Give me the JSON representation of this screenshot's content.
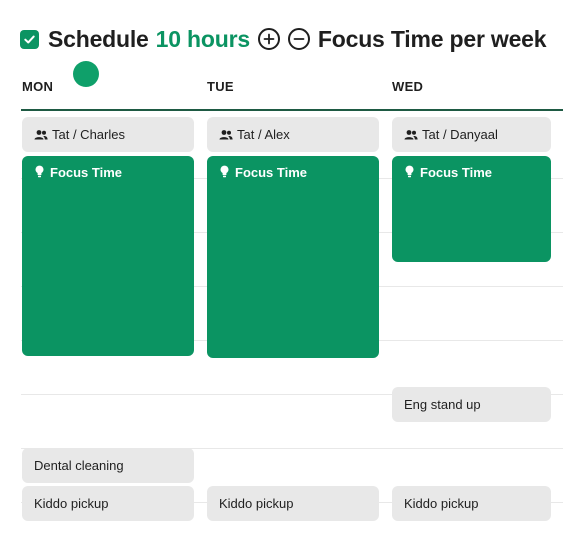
{
  "header": {
    "schedule_label": "Schedule",
    "hours_value": "10 hours",
    "tail_label": "Focus Time per week"
  },
  "colors": {
    "accent": "#0b9462",
    "event_gray": "#e8e8e8",
    "rule": "#1e5a43"
  },
  "days": [
    {
      "label": "MON",
      "meeting": "Tat / Charles",
      "focus": "Focus Time",
      "dental": "Dental cleaning",
      "pickup": "Kiddo pickup"
    },
    {
      "label": "TUE",
      "meeting": "Tat / Alex",
      "focus": "Focus Time",
      "pickup": "Kiddo pickup"
    },
    {
      "label": "WED",
      "meeting": "Tat / Danyaal",
      "focus": "Focus Time",
      "standup": "Eng stand up",
      "pickup": "Kiddo pickup"
    }
  ]
}
